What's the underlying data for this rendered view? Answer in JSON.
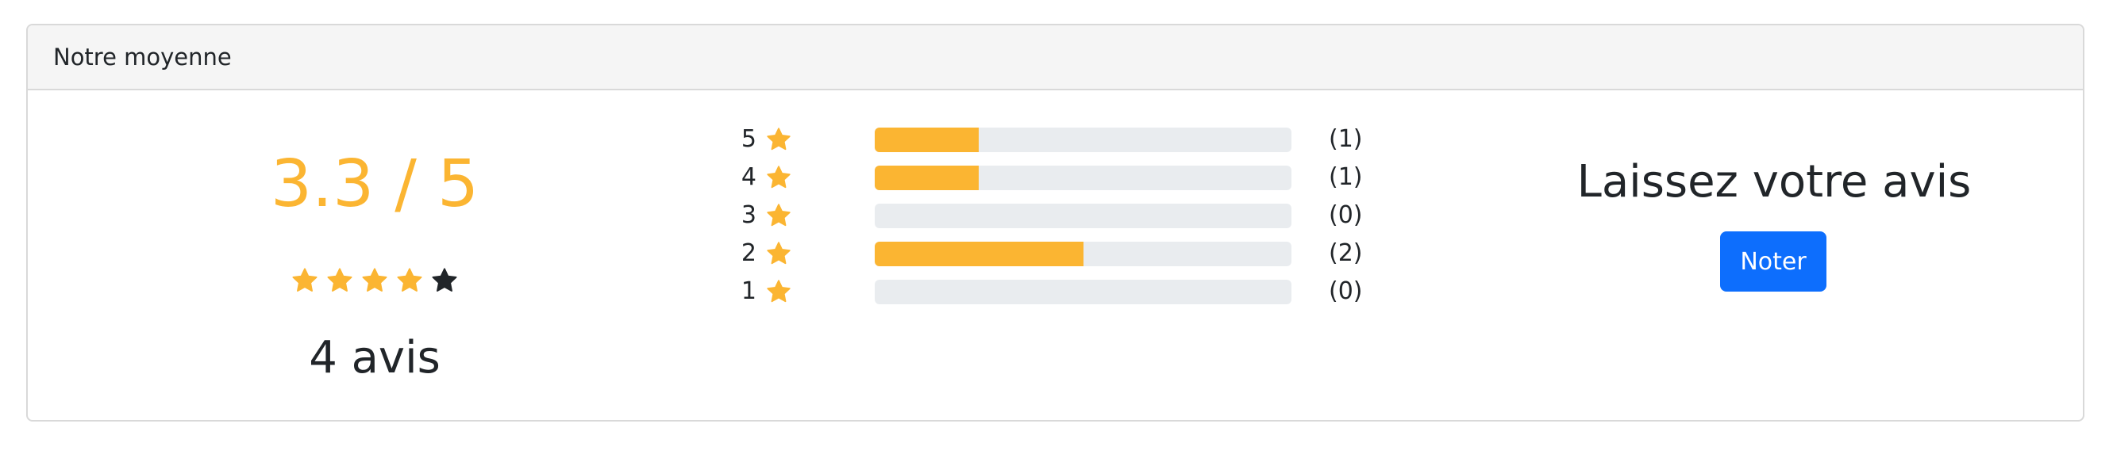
{
  "header": {
    "title": "Notre moyenne"
  },
  "summary": {
    "score_text": "3.3 / 5",
    "stars": [
      {
        "filled": true
      },
      {
        "filled": true
      },
      {
        "filled": true
      },
      {
        "filled": true
      },
      {
        "filled": false
      }
    ],
    "review_count_text": "4 avis"
  },
  "distribution": [
    {
      "stars": "5",
      "count_text": "(1)",
      "fill_percent": 25
    },
    {
      "stars": "4",
      "count_text": "(1)",
      "fill_percent": 25
    },
    {
      "stars": "3",
      "count_text": "(0)",
      "fill_percent": 0
    },
    {
      "stars": "2",
      "count_text": "(2)",
      "fill_percent": 50
    },
    {
      "stars": "1",
      "count_text": "(0)",
      "fill_percent": 0
    }
  ],
  "cta": {
    "title": "Laissez votre avis",
    "button_label": "Noter"
  },
  "colors": {
    "accent": "#fbb532",
    "empty_star": "#212529",
    "track": "#e9ecef",
    "primary_button": "#0d6efd"
  }
}
